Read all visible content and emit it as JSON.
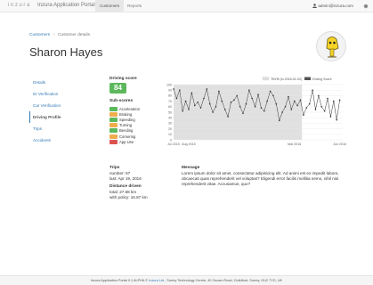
{
  "navbar": {
    "brand": "inzura",
    "title": "Inzura Application Portal",
    "tabs": [
      {
        "label": "Customers",
        "active": true
      },
      {
        "label": "Reports",
        "active": false
      }
    ],
    "user": "admin@inzura.com",
    "gear_icon": "gear-icon"
  },
  "breadcrumb": {
    "items": [
      "Customers",
      "Customer details"
    ]
  },
  "customer": {
    "name": "Sharon Hayes"
  },
  "sidenav": {
    "items": [
      {
        "label": "Details",
        "active": false
      },
      {
        "label": "ID Verification",
        "active": false
      },
      {
        "label": "Car Verification",
        "active": false
      },
      {
        "label": "Driving Profile",
        "active": true
      },
      {
        "label": "Trips",
        "active": false
      },
      {
        "label": "Accidents",
        "active": false
      }
    ]
  },
  "driving": {
    "score_label": "Driving score",
    "score": "84",
    "subscores_label": "Sub-scores",
    "subscores": [
      {
        "label": "Acceleration",
        "value": "",
        "color": "#5cb85c"
      },
      {
        "label": "Braking",
        "value": "",
        "color": "#f0ad4e"
      },
      {
        "label": "Speeding",
        "value": "",
        "color": "#5cb85c"
      },
      {
        "label": "Turning",
        "value": "",
        "color": "#f0ad4e"
      },
      {
        "label": "Bending",
        "value": "",
        "color": "#5cb85c"
      },
      {
        "label": "Cornering",
        "value": "",
        "color": "#f0ad4e"
      },
      {
        "label": "App Use",
        "value": "",
        "color": "#d9534f"
      }
    ]
  },
  "chart_data": {
    "type": "line",
    "legend": [
      "TBYB (to 2016-01-02)",
      "Driving Score"
    ],
    "legend_placement": "top-right",
    "colors": {
      "band": "#e0e0e0",
      "series": "#333333"
    },
    "ylim": [
      0,
      100
    ],
    "yticks": [
      "0",
      "10",
      "20",
      "30",
      "40",
      "50",
      "60",
      "70",
      "80",
      "90",
      "100"
    ],
    "xlim": [
      0,
      11.2
    ],
    "xticks": [
      {
        "label": "Jul 2015",
        "x": 0
      },
      {
        "label": "Aug 2015",
        "x": 1
      },
      {
        "label": "Mar 2016",
        "x": 8
      },
      {
        "label": "Jun 2016",
        "x": 11
      }
    ],
    "band": {
      "x_from": 0,
      "x_to": 8.5
    },
    "grid": true,
    "series": [
      {
        "values": [
          [
            0.0,
            92
          ],
          [
            0.2,
            75
          ],
          [
            0.4,
            90
          ],
          [
            0.6,
            52
          ],
          [
            0.8,
            70
          ],
          [
            1.0,
            55
          ],
          [
            1.2,
            85
          ],
          [
            1.4,
            62
          ],
          [
            1.6,
            68
          ],
          [
            1.8,
            58
          ],
          [
            2.0,
            75
          ],
          [
            2.2,
            92
          ],
          [
            2.4,
            65
          ],
          [
            2.6,
            50
          ],
          [
            2.8,
            60
          ],
          [
            3.0,
            88
          ],
          [
            3.2,
            70
          ],
          [
            3.4,
            55
          ],
          [
            3.6,
            42
          ],
          [
            3.8,
            68
          ],
          [
            4.0,
            72
          ],
          [
            4.2,
            80
          ],
          [
            4.4,
            60
          ],
          [
            4.6,
            48
          ],
          [
            4.8,
            65
          ],
          [
            5.0,
            90
          ],
          [
            5.2,
            75
          ],
          [
            5.4,
            60
          ],
          [
            5.6,
            82
          ],
          [
            5.8,
            58
          ],
          [
            6.0,
            52
          ],
          [
            6.2,
            70
          ],
          [
            6.4,
            88
          ],
          [
            6.6,
            80
          ],
          [
            6.8,
            65
          ],
          [
            7.0,
            35
          ],
          [
            7.2,
            50
          ],
          [
            7.4,
            60
          ],
          [
            7.6,
            78
          ],
          [
            7.8,
            55
          ],
          [
            8.0,
            70
          ],
          [
            8.2,
            62
          ],
          [
            8.4,
            72
          ],
          [
            8.6,
            45
          ],
          [
            8.8,
            58
          ],
          [
            9.0,
            65
          ],
          [
            9.2,
            90
          ],
          [
            9.4,
            55
          ],
          [
            9.6,
            80
          ],
          [
            9.8,
            60
          ],
          [
            10.0,
            52
          ],
          [
            10.2,
            75
          ],
          [
            10.4,
            42
          ],
          [
            10.6,
            70
          ],
          [
            10.8,
            36
          ],
          [
            11.0,
            72
          ]
        ]
      }
    ]
  },
  "trips": {
    "heading": "Trips",
    "number_line": "number: 67",
    "last_line": "last: Apr 19, 2016",
    "distance_heading": "Distance driven",
    "total_line": "total: 27.68 km",
    "policy_line": "with policy: 16.87 km"
  },
  "message": {
    "heading": "Message",
    "text": "Lorem ipsum dolor sit amet, consectetur adipisicing elit. Ad animi est ex impedit labore, obcaecati quas reprehenderit vel voluptas? Eligendi error facilis mollitia nemo, nihil nisi reprehenderit vitae. Accusamus, quo?"
  },
  "footer": {
    "prefix": "Inzura Application Portal 0.1 ALPHA © ",
    "company": "Inzura Ltd.",
    "suffix": ", Surrey Technology Centre, 40 Occam Road, Guildford, Surrey, GU2 7YG, UK"
  }
}
